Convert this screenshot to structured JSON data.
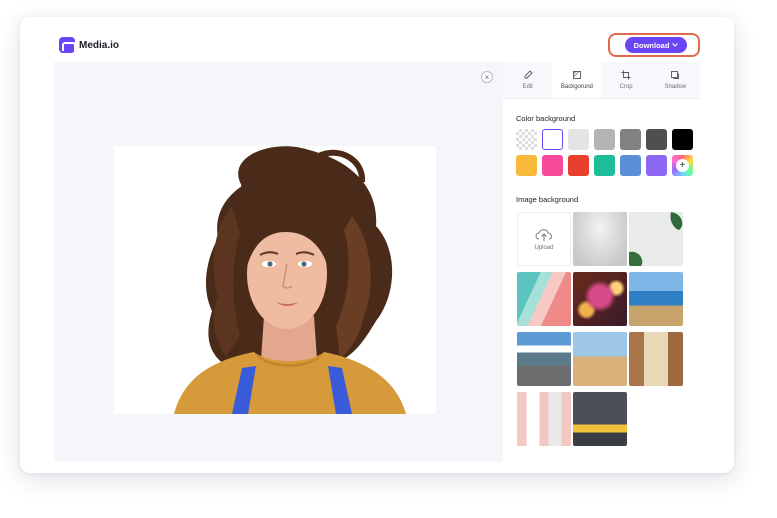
{
  "app": {
    "name": "Media.io"
  },
  "header": {
    "download_label": "Download"
  },
  "canvas": {
    "close_symbol": "×"
  },
  "tabs": [
    {
      "label": "Edit",
      "icon": "brush-icon"
    },
    {
      "label": "Backgorund",
      "icon": "background-icon"
    },
    {
      "label": "Crop",
      "icon": "crop-icon"
    },
    {
      "label": "Shadow",
      "icon": "shadow-icon"
    }
  ],
  "color_background": {
    "title": "Color background",
    "swatches": [
      "transparent",
      "#ffffff",
      "#e4e4e6",
      "#b4b4b6",
      "#828284",
      "#4f4f51",
      "#000000",
      "#f9b93b",
      "#f74c9b",
      "#e8402f",
      "#1ebd9a",
      "#5b8fd8",
      "#8e67f5",
      "custom"
    ]
  },
  "image_background": {
    "title": "Image background",
    "upload_label": "Upload"
  },
  "colors": {
    "accent": "#6a45f5",
    "highlight": "#e06a4e"
  }
}
